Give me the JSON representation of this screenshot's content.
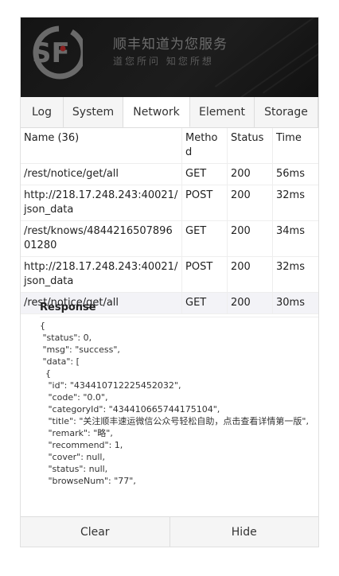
{
  "banner": {
    "slogan": "顺丰知道为您服务",
    "subslogan": "道您所问  知您所想"
  },
  "tabs": [
    {
      "label": "Log",
      "active": false
    },
    {
      "label": "System",
      "active": false
    },
    {
      "label": "Network",
      "active": true
    },
    {
      "label": "Element",
      "active": false
    },
    {
      "label": "Storage",
      "active": false
    }
  ],
  "network": {
    "headers": {
      "name": "Name (36)",
      "method": "Method",
      "status": "Status",
      "time": "Time"
    },
    "rows": [
      {
        "name": "/rest/notice/get/all",
        "method": "GET",
        "status": "200",
        "time": "56ms"
      },
      {
        "name": "http://218.17.248.243:40021/json_data",
        "method": "POST",
        "status": "200",
        "time": "32ms"
      },
      {
        "name": "/rest/knows/484421650789601280",
        "method": "GET",
        "status": "200",
        "time": "34ms"
      },
      {
        "name": "http://218.17.248.243:40021/json_data",
        "method": "POST",
        "status": "200",
        "time": "32ms"
      },
      {
        "name": "/rest/notice/get/all",
        "method": "GET",
        "status": "200",
        "time": "30ms"
      }
    ]
  },
  "response": {
    "title": "Response",
    "body": "{\n \"status\": 0,\n \"msg\": \"success\",\n \"data\": [\n  {\n   \"id\": \"434410712225452032\",\n   \"code\": \"0.0\",\n   \"categoryId\": \"434410665744175104\",\n   \"title\": \"关注顺丰速运微信公众号轻松自助，点击查看详情第一版\",\n   \"remark\": \"略\",\n   \"recommend\": 1,\n   \"cover\": null,\n   \"status\": null,\n   \"browseNum\": \"77\","
  },
  "footer": {
    "clear": "Clear",
    "hide": "Hide"
  }
}
